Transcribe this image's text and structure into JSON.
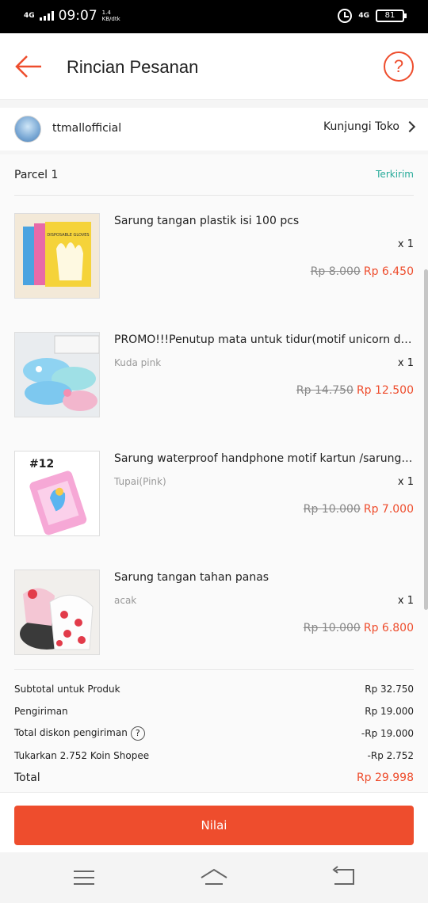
{
  "status_bar": {
    "network_left": "4G",
    "time": "09:07",
    "speed_value": "1.4",
    "speed_unit": "KB/dtk",
    "network_right": "4G",
    "battery": "81"
  },
  "header": {
    "title": "Rincian Pesanan",
    "help_label": "?"
  },
  "shop": {
    "name": "ttmallofficial",
    "visit_label": "Kunjungi Toko"
  },
  "parcel": {
    "label": "Parcel 1",
    "status": "Terkirim"
  },
  "items": [
    {
      "name": "Sarung tangan plastik isi 100 pcs",
      "variant": "",
      "qty": "x 1",
      "old_price": "Rp 8.000",
      "new_price": "Rp 6.450",
      "image_text": "DISPOSABLE GLOVES"
    },
    {
      "name": "PROMO!!!Penutup mata untuk tidur(motif unicorn dan flamingo)",
      "variant": "Kuda pink",
      "qty": "x 1",
      "old_price": "Rp 14.750",
      "new_price": "Rp 12.500"
    },
    {
      "name": "Sarung waterproof handphone motif kartun /sarung hp",
      "variant": "Tupai(Pink)",
      "qty": "x 1",
      "old_price": "Rp 10.000",
      "new_price": "Rp 7.000",
      "image_text": "#12"
    },
    {
      "name": "Sarung tangan tahan panas",
      "variant": "acak",
      "qty": "x 1",
      "old_price": "Rp 10.000",
      "new_price": "Rp 6.800"
    }
  ],
  "summary": {
    "subtotal_label": "Subtotal untuk Produk",
    "subtotal_value": "Rp 32.750",
    "shipping_label": "Pengiriman",
    "shipping_value": "Rp 19.000",
    "shipping_discount_label": "Total diskon pengiriman",
    "shipping_discount_value": "-Rp 19.000",
    "coins_label": "Tukarkan 2.752 Koin Shopee",
    "coins_value": "-Rp 2.752",
    "total_label": "Total",
    "total_value": "Rp 29.998"
  },
  "actions": {
    "rate_label": "Nilai"
  },
  "colors": {
    "accent": "#ee4d2d",
    "status_delivered": "#26aa99"
  }
}
